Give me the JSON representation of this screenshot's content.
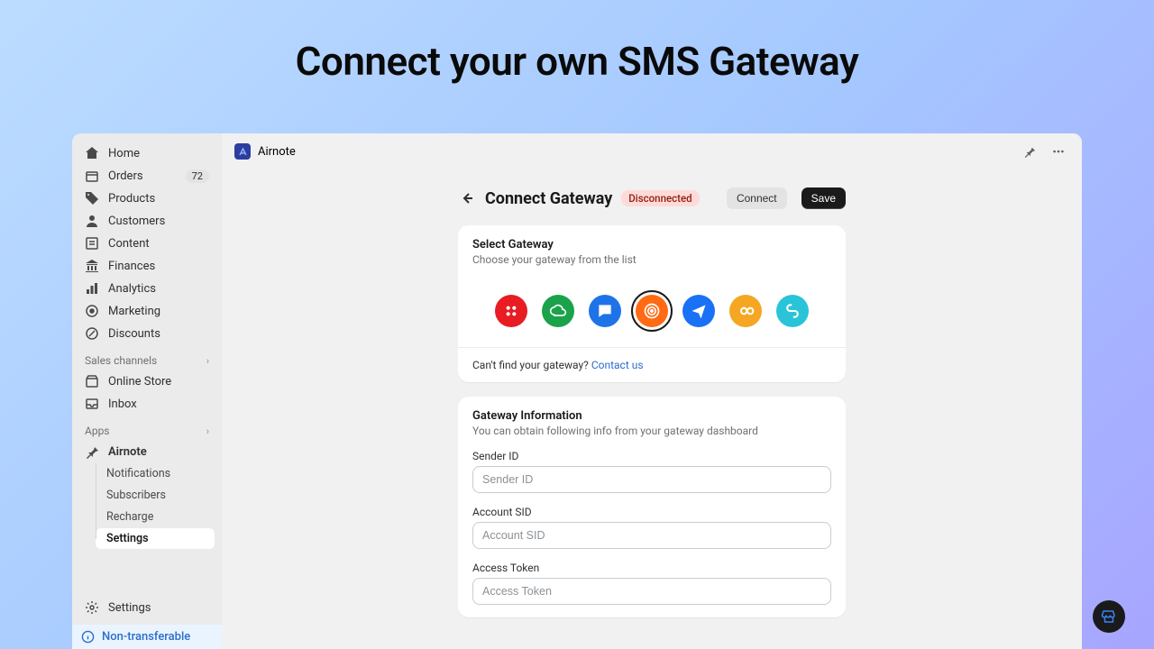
{
  "hero": "Connect your own SMS Gateway",
  "appName": "Airnote",
  "sidebar": {
    "nav": [
      {
        "label": "Home"
      },
      {
        "label": "Orders",
        "badge": "72"
      },
      {
        "label": "Products"
      },
      {
        "label": "Customers"
      },
      {
        "label": "Content"
      },
      {
        "label": "Finances"
      },
      {
        "label": "Analytics"
      },
      {
        "label": "Marketing"
      },
      {
        "label": "Discounts"
      }
    ],
    "salesChannelsLabel": "Sales channels",
    "salesChannels": [
      {
        "label": "Online Store"
      },
      {
        "label": "Inbox"
      }
    ],
    "appsLabel": "Apps",
    "currentApp": "Airnote",
    "appNav": [
      {
        "label": "Notifications"
      },
      {
        "label": "Subscribers"
      },
      {
        "label": "Recharge"
      },
      {
        "label": "Settings",
        "active": true
      }
    ],
    "settings": "Settings",
    "nonTransferable": "Non-transferable"
  },
  "header": {
    "title": "Connect Gateway",
    "status": "Disconnected",
    "connect": "Connect",
    "save": "Save"
  },
  "selectCard": {
    "title": "Select Gateway",
    "subtitle": "Choose your gateway from the list",
    "hintPrefix": "Can't find your gateway? ",
    "hintLink": "Contact us",
    "gateways": [
      {
        "name": "twilio",
        "color": "red"
      },
      {
        "name": "whatsapp-cloud",
        "color": "green"
      },
      {
        "name": "clickatell",
        "color": "blue"
      },
      {
        "name": "messagebird",
        "color": "orange",
        "selected": true
      },
      {
        "name": "telnyx",
        "color": "blue2"
      },
      {
        "name": "plivo",
        "color": "yellow"
      },
      {
        "name": "vonage",
        "color": "cyan"
      }
    ]
  },
  "infoCard": {
    "title": "Gateway Information",
    "subtitle": "You can obtain following info from your gateway dashboard",
    "fields": [
      {
        "label": "Sender ID",
        "placeholder": "Sender ID"
      },
      {
        "label": "Account SID",
        "placeholder": "Account SID"
      },
      {
        "label": "Access Token",
        "placeholder": "Access Token"
      }
    ]
  }
}
